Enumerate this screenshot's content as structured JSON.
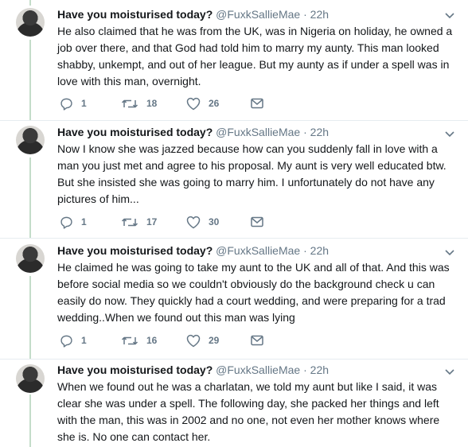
{
  "tweets": [
    {
      "name": "Have you moisturised today?",
      "handle": "@FuxkSallieMae",
      "dot": "·",
      "time": "22h",
      "text": "He also claimed that he was from the UK, was in Nigeria on holiday, he owned a job over there, and that God had told him to marry my aunty. This man looked shabby, unkempt, and out of her league. But my aunty as if under a spell was in love with this man, overnight.",
      "replies": "1",
      "retweets": "18",
      "likes": "26"
    },
    {
      "name": "Have you moisturised today?",
      "handle": "@FuxkSallieMae",
      "dot": "·",
      "time": "22h",
      "text": "Now I know she was jazzed because how can you suddenly fall in love with a man you just met and agree to his proposal. My aunt is very well educated btw. But she insisted she was going to marry him. I unfortunately do not have any pictures of him...",
      "replies": "1",
      "retweets": "17",
      "likes": "30"
    },
    {
      "name": "Have you moisturised today?",
      "handle": "@FuxkSallieMae",
      "dot": "·",
      "time": "22h",
      "text": "He claimed he was going to take my aunt to the UK and all of that. And this was before social media so we couldn't obviously do the background check u can easily do now.  They quickly had a court wedding, and were preparing for a trad wedding..When we found out this man was lying",
      "replies": "1",
      "retweets": "16",
      "likes": "29"
    },
    {
      "name": "Have you moisturised today?",
      "handle": "@FuxkSallieMae",
      "dot": "·",
      "time": "22h",
      "text": "When we found out he was a charlatan, we told my aunt but like I said, it was clear she was under a spell. The following day, she packed her things and left with the man,  this was in 2002 and no one, not even her mother knows where she is. No one can contact her."
    }
  ],
  "icons": {
    "reply": "reply-icon",
    "retweet": "retweet-icon",
    "like": "heart-icon",
    "dm": "envelope-icon",
    "caret": "chevron-down-icon"
  },
  "colors": {
    "thread_line": "#c4ddc9",
    "secondary_text": "#657786",
    "divider": "#e6ecf0"
  }
}
